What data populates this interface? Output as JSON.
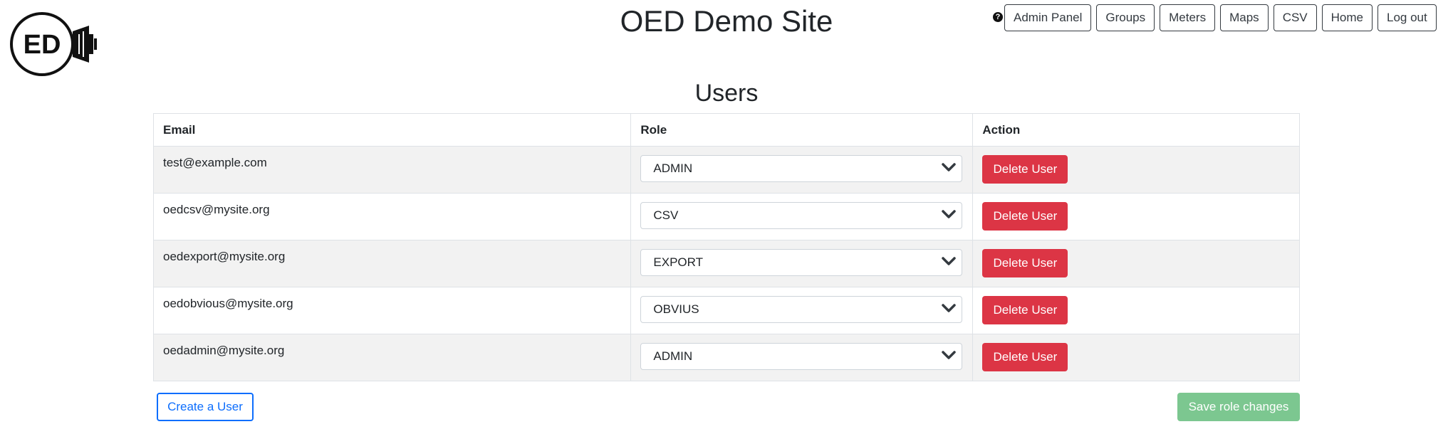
{
  "header": {
    "logo_text": "ED",
    "site_title": "OED Demo Site",
    "help_icon": "question-circle-icon",
    "nav": [
      {
        "label": "Admin Panel"
      },
      {
        "label": "Groups"
      },
      {
        "label": "Meters"
      },
      {
        "label": "Maps"
      },
      {
        "label": "CSV"
      },
      {
        "label": "Home"
      },
      {
        "label": "Log out"
      }
    ]
  },
  "main": {
    "heading": "Users",
    "table": {
      "columns": [
        "Email",
        "Role",
        "Action"
      ],
      "rows": [
        {
          "email": "test@example.com",
          "role": "ADMIN",
          "action": "Delete User"
        },
        {
          "email": "oedcsv@mysite.org",
          "role": "CSV",
          "action": "Delete User"
        },
        {
          "email": "oedexport@mysite.org",
          "role": "EXPORT",
          "action": "Delete User"
        },
        {
          "email": "oedobvious@mysite.org",
          "role": "OBVIUS",
          "action": "Delete User"
        },
        {
          "email": "oedadmin@mysite.org",
          "role": "ADMIN",
          "action": "Delete User"
        }
      ]
    },
    "create_user_label": "Create a User",
    "save_label": "Save role changes"
  },
  "colors": {
    "danger": "#dc3545",
    "primary": "#0d6efd",
    "success_disabled": "#7cc790",
    "nav_border": "#343a40"
  }
}
